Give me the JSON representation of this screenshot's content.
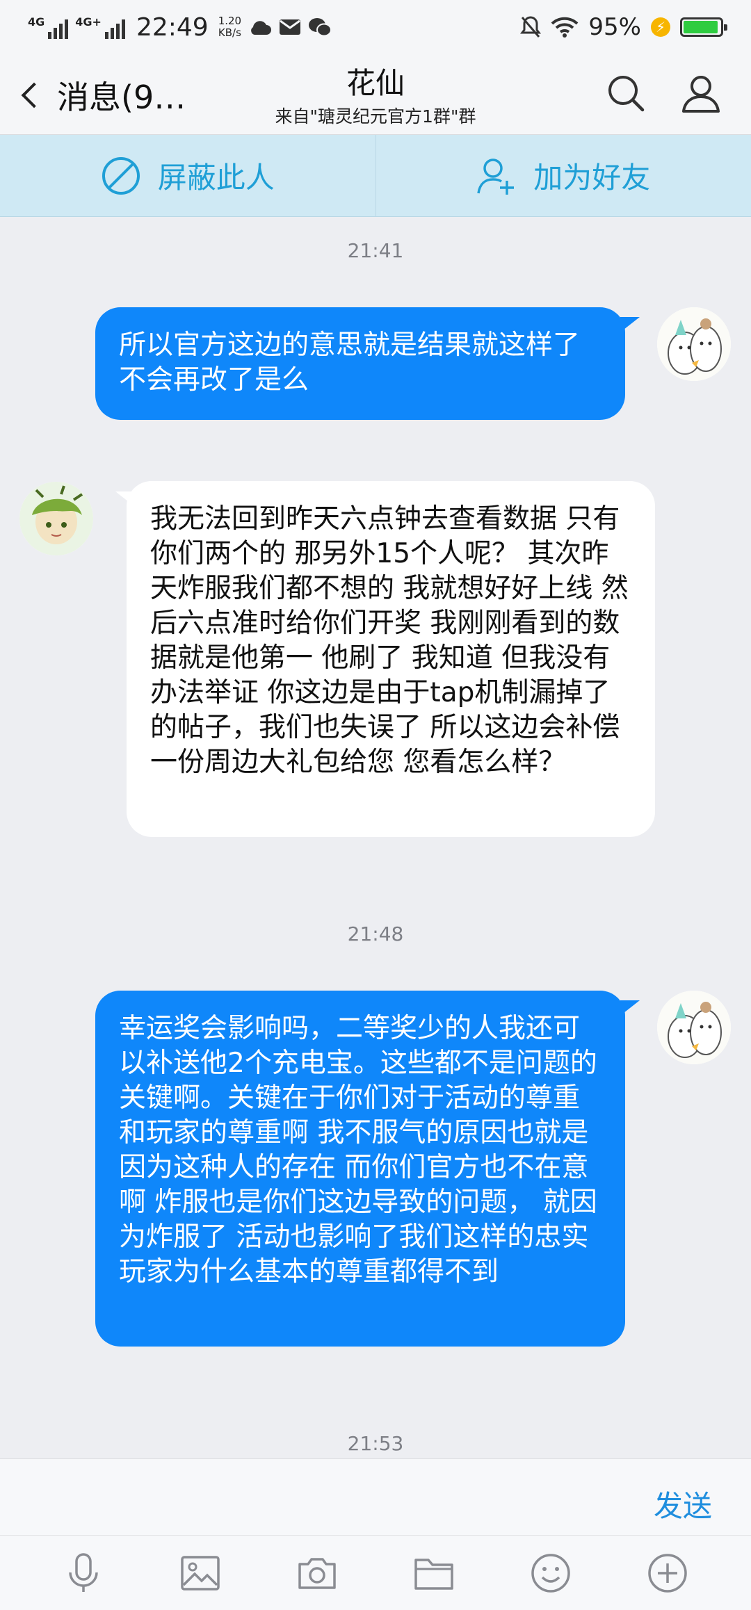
{
  "status_bar": {
    "network_1": "4G",
    "network_2": "4G+",
    "time": "22:49",
    "speed_value": "1.20",
    "speed_unit": "KB/s",
    "battery": "95%",
    "battery_level": 0.95
  },
  "header": {
    "back_label": "消息(9…",
    "title": "花仙",
    "subtitle": "来自\"瑭灵纪元官方1群\"群"
  },
  "actions": {
    "block_label": "屏蔽此人",
    "add_friend_label": "加为好友"
  },
  "messages": [
    {
      "type": "timestamp",
      "text": "21:41"
    },
    {
      "type": "out",
      "text": "所以官方这边的意思就是结果就这样了 不会再改了是么"
    },
    {
      "type": "in",
      "text": "我无法回到昨天六点钟去查看数据 只有你们两个的 那另外15个人呢？ 其次昨天炸服我们都不想的 我就想好好上线 然后六点准时给你们开奖 我刚刚看到的数据就是他第一 他刷了 我知道 但我没有办法举证  你这边是由于tap机制漏掉了的帖子，我们也失误了 所以这边会补偿一份周边大礼包给您 您看怎么样？"
    },
    {
      "type": "timestamp",
      "text": "21:48"
    },
    {
      "type": "out",
      "text": "幸运奖会影响吗，二等奖少的人我还可以补送他2个充电宝。这些都不是问题的关键啊。关键在于你们对于活动的尊重和玩家的尊重啊 我不服气的原因也就是因为这种人的存在 而你们官方也不在意啊  炸服也是你们这边导致的问题， 就因为炸服了 活动也影响了我们这样的忠实玩家为什么基本的尊重都得不到"
    },
    {
      "type": "timestamp",
      "text": "21:53"
    }
  ],
  "input": {
    "send_label": "发送"
  },
  "toolbar": {
    "icons": [
      "microphone-icon",
      "image-icon",
      "camera-icon",
      "folder-icon",
      "emoji-icon",
      "plus-icon"
    ]
  },
  "colors": {
    "outgoing_bubble": "#0f87fa",
    "incoming_bubble": "#ffffff",
    "accent": "#1f9fd6",
    "background": "#edeef2"
  }
}
